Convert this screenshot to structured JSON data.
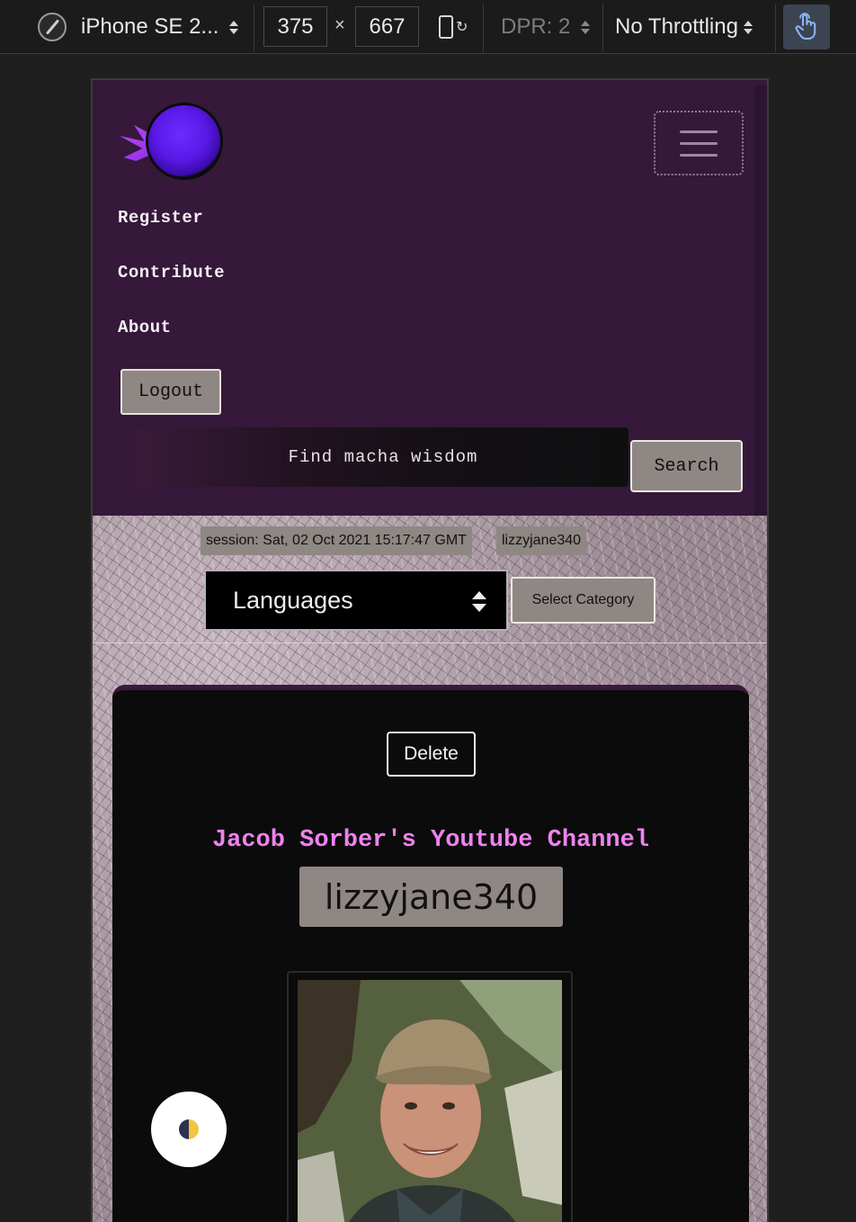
{
  "devtools": {
    "device": "iPhone SE 2...",
    "width": "375",
    "times": "×",
    "height": "667",
    "dpr": "DPR: 2",
    "throttling": "No Throttling"
  },
  "nav": {
    "links": [
      "Register",
      "Contribute",
      "About"
    ],
    "logout_label": "Logout",
    "search_placeholder": "Find macha wisdom",
    "search_label": "Search"
  },
  "session": {
    "text": "session: Sat, 02 Oct 2021 15:17:47 GMT",
    "user": "lizzyjane340"
  },
  "filters": {
    "language_selected": "Languages",
    "category_button": "Select Category"
  },
  "card": {
    "delete_label": "Delete",
    "title": "Jacob Sorber's Youtube Channel",
    "username": "lizzyjane340"
  }
}
